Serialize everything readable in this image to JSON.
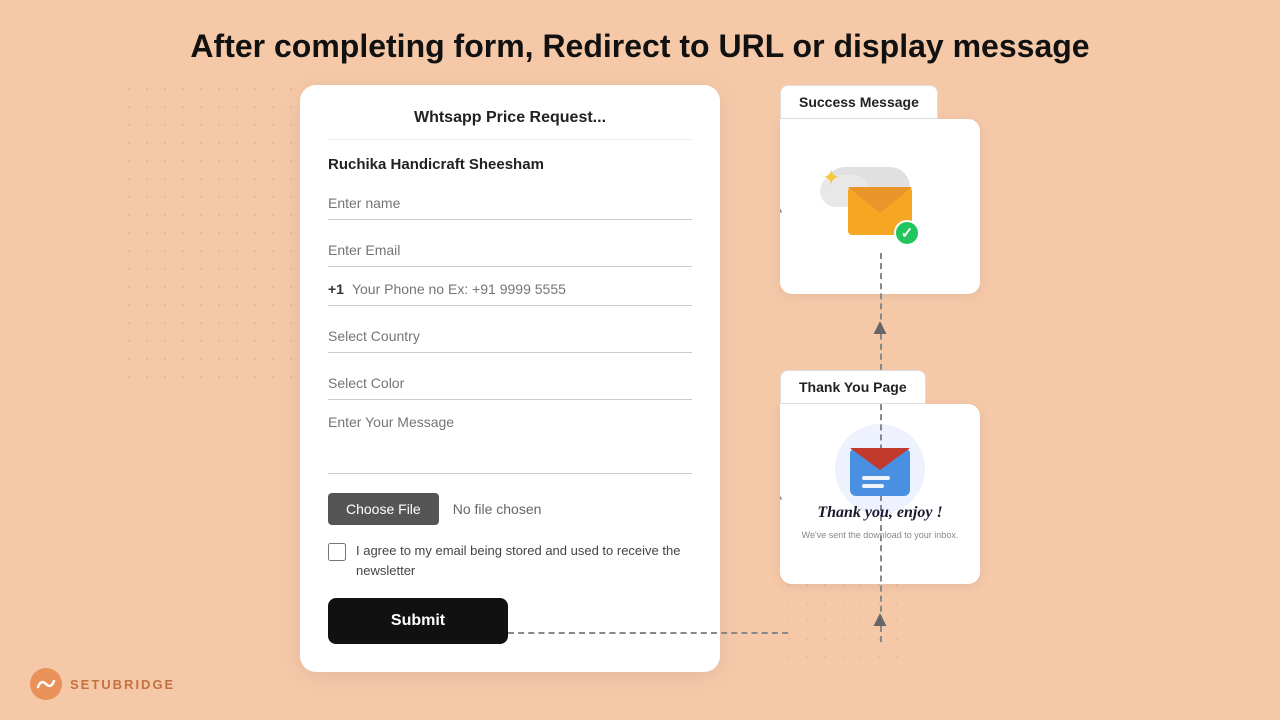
{
  "page": {
    "header": "After completing form, Redirect to URL or display message",
    "background_color": "#f5c9a8"
  },
  "form": {
    "title": "Whtsapp Price Request...",
    "product_name": "Ruchika Handicraft Sheesham",
    "fields": {
      "name_placeholder": "Enter name",
      "email_placeholder": "Enter Email",
      "phone_code": "+1",
      "phone_placeholder": "Your Phone no Ex: +91 9999 5555",
      "country_placeholder": "Select Country",
      "color_placeholder": "Select Color",
      "message_placeholder": "Enter Your Message",
      "file_button": "Choose File",
      "file_label": "No file chosen",
      "checkbox_text": "I agree to my email being stored and used to receive the newsletter",
      "submit_button": "Submit"
    }
  },
  "right_panels": {
    "success_tab": "Success Message",
    "thankyou_tab": "Thank You Page",
    "thankyou_text": "Thank you, enjoy !",
    "thankyou_subtext": "We've sent the download to your inbox."
  },
  "logo": {
    "text": "SETUBRIDGE",
    "icon": "🌉"
  }
}
